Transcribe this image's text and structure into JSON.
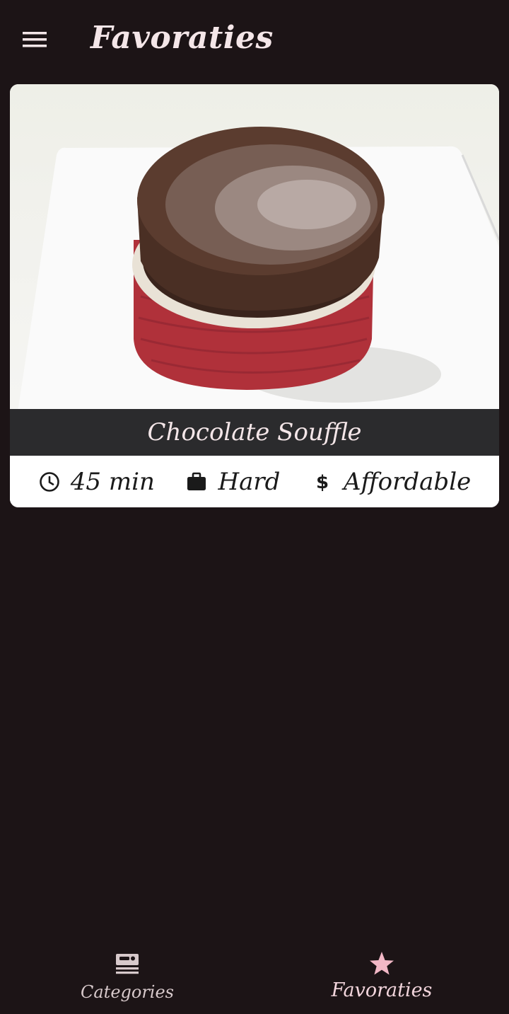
{
  "app_bar": {
    "title": "Favoraties",
    "menu_icon": "menu-icon"
  },
  "meals": [
    {
      "title": "Chocolate Souffle",
      "image_icon": "chocolate-souffle-photo",
      "duration": "45 min",
      "duration_icon": "clock-icon",
      "complexity": "Hard",
      "complexity_icon": "briefcase-icon",
      "affordability": "Affordable",
      "affordability_icon": "dollar-icon"
    }
  ],
  "bottom_nav": {
    "items": [
      {
        "label": "Categories",
        "icon": "categories-icon",
        "active": false
      },
      {
        "label": "Favoraties",
        "icon": "star-icon",
        "active": true
      }
    ]
  },
  "colors": {
    "background": "#1c1416",
    "title_text": "#f4e6e8",
    "active_accent": "#f2b8c6",
    "inactive_nav": "#d7c9cb",
    "title_bar": "#242426"
  }
}
